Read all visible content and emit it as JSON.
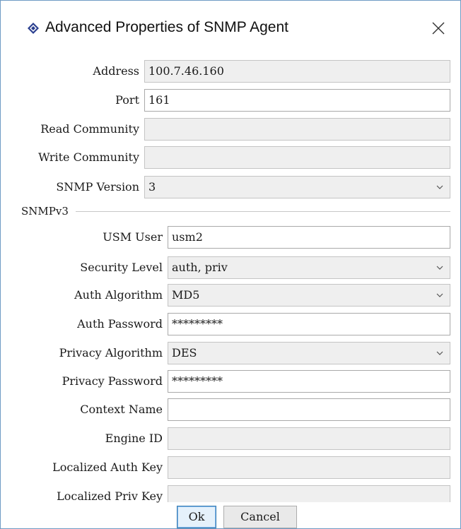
{
  "window": {
    "title": "Advanced Properties of SNMP Agent"
  },
  "fields": {
    "address": {
      "label": "Address",
      "value": "100.7.46.160"
    },
    "port": {
      "label": "Port",
      "value": "161"
    },
    "read_community": {
      "label": "Read Community",
      "value": ""
    },
    "write_community": {
      "label": "Write Community",
      "value": ""
    },
    "snmp_version": {
      "label": "SNMP Version",
      "value": "3"
    }
  },
  "snmpv3": {
    "section_title": "SNMPv3",
    "usm_user": {
      "label": "USM User",
      "value": "usm2"
    },
    "security_level": {
      "label": "Security Level",
      "value": "auth, priv"
    },
    "auth_algorithm": {
      "label": "Auth Algorithm",
      "value": "MD5"
    },
    "auth_password": {
      "label": "Auth Password",
      "value": "*********"
    },
    "privacy_algorithm": {
      "label": "Privacy Algorithm",
      "value": "DES"
    },
    "privacy_password": {
      "label": "Privacy Password",
      "value": "*********"
    },
    "context_name": {
      "label": "Context Name",
      "value": ""
    },
    "engine_id": {
      "label": "Engine ID",
      "value": ""
    },
    "localized_auth_key": {
      "label": "Localized Auth Key",
      "value": ""
    },
    "localized_priv_key": {
      "label": "Localized Priv Key",
      "value": ""
    }
  },
  "buttons": {
    "ok": "Ok",
    "cancel": "Cancel"
  },
  "colors": {
    "window_border": "#6f9bc4",
    "disabled_field": "#efefef",
    "default_button_border": "#3c7fb1"
  }
}
